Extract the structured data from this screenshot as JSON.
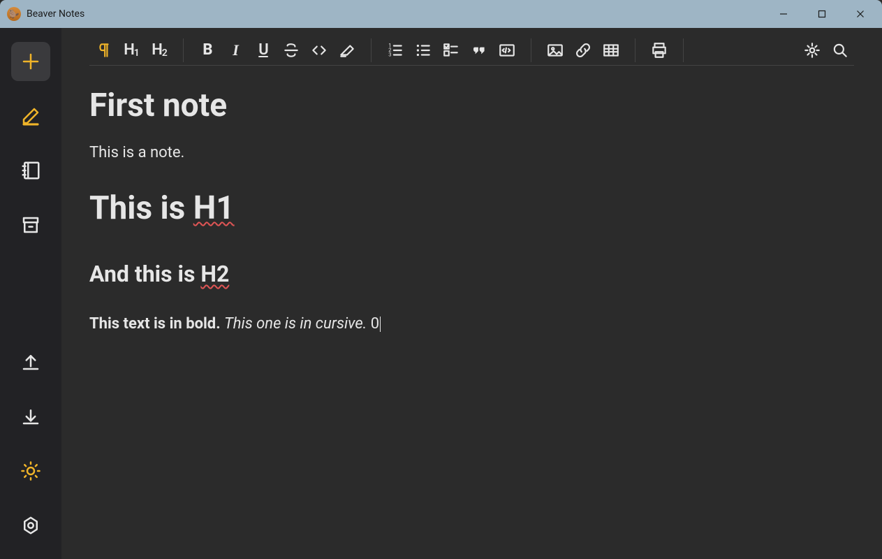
{
  "window": {
    "title": "Beaver Notes",
    "app_icon_emoji": "🦫"
  },
  "sidebar": {
    "items": [
      {
        "name": "add",
        "icon": "plus-icon",
        "active": false
      },
      {
        "name": "edit",
        "icon": "pencil-icon",
        "active": true
      },
      {
        "name": "notes",
        "icon": "notebook-icon",
        "active": false
      },
      {
        "name": "archive",
        "icon": "archive-icon",
        "active": false
      }
    ],
    "bottom": [
      {
        "name": "export",
        "icon": "upload-icon"
      },
      {
        "name": "import",
        "icon": "download-icon"
      },
      {
        "name": "theme",
        "icon": "sun-icon"
      },
      {
        "name": "settings",
        "icon": "settings-icon"
      }
    ]
  },
  "toolbar": {
    "paragraph_label": "¶",
    "h1_label": "H1",
    "h2_label": "H2"
  },
  "note": {
    "title": "First note",
    "p1": "This is a note.",
    "h1_pre": "This is ",
    "h1_err": "H1",
    "h2_pre": "And this is ",
    "h2_err": "H2",
    "bold": "This text is in bold.",
    "italic": "This one is in cursive.",
    "tail": " 0"
  }
}
